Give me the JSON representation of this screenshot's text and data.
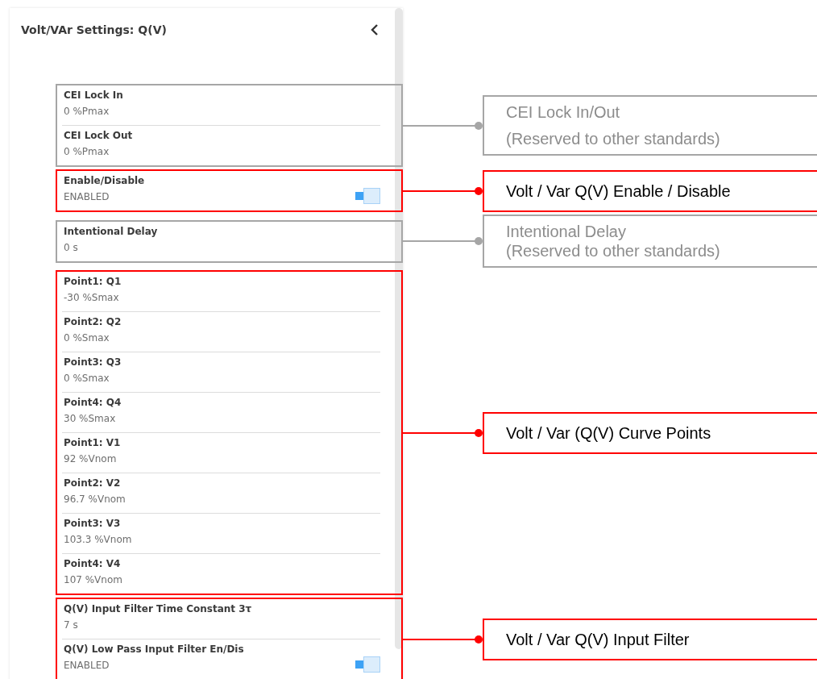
{
  "panel": {
    "title": "Volt/VAr Settings: Q(V)"
  },
  "groups": [
    {
      "reserved": true,
      "items": [
        {
          "label": "CEI Lock In",
          "value": "0 %Pmax"
        },
        {
          "label": "CEI Lock Out",
          "value": "0 %Pmax"
        }
      ],
      "callout": {
        "lines": [
          "CEI Lock In/Out",
          "(Reserved to other standards)"
        ]
      }
    },
    {
      "reserved": false,
      "items": [
        {
          "label": "Enable/Disable",
          "value": "ENABLED",
          "kind": "toggle",
          "on": true
        }
      ],
      "callout": {
        "lines": [
          "Volt / Var Q(V) Enable / Disable"
        ]
      }
    },
    {
      "reserved": true,
      "items": [
        {
          "label": "Intentional Delay",
          "value": "0 s"
        }
      ],
      "callout": {
        "lines": [
          "Intentional Delay",
          "(Reserved to other standards)"
        ]
      }
    },
    {
      "reserved": false,
      "items": [
        {
          "label": "Point1: Q1",
          "value": "-30 %Smax"
        },
        {
          "label": "Point2: Q2",
          "value": "0 %Smax"
        },
        {
          "label": "Point3: Q3",
          "value": "0 %Smax"
        },
        {
          "label": "Point4: Q4",
          "value": "30 %Smax"
        },
        {
          "label": "Point1: V1",
          "value": "92 %Vnom"
        },
        {
          "label": "Point2: V2",
          "value": "96.7 %Vnom"
        },
        {
          "label": "Point3: V3",
          "value": "103.3 %Vnom"
        },
        {
          "label": "Point4: V4",
          "value": "107 %Vnom"
        }
      ],
      "callout": {
        "lines": [
          "Volt / Var (Q(V) Curve Points"
        ]
      }
    },
    {
      "reserved": false,
      "items": [
        {
          "label": "Q(V) Input Filter Time Constant 3τ",
          "value": "7 s"
        },
        {
          "label": "Q(V) Low Pass Input Filter En/Dis",
          "value": "ENABLED",
          "kind": "toggle",
          "on": true
        }
      ],
      "callout": {
        "lines": [
          "Volt / Var Q(V) Input Filter"
        ]
      }
    }
  ]
}
